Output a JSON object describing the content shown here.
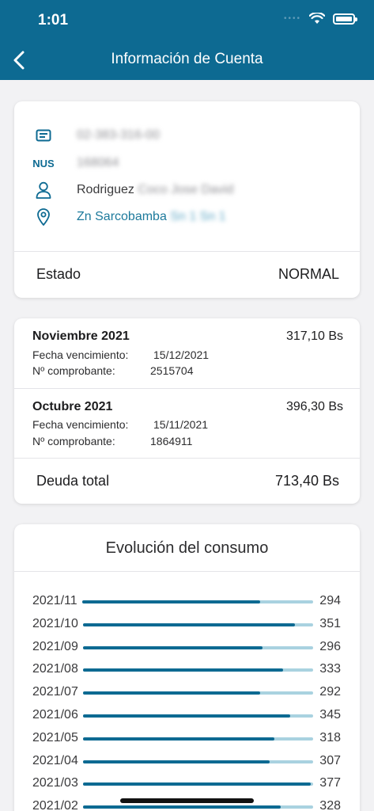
{
  "status_bar": {
    "time": "1:01",
    "icons": [
      "cellular-icon",
      "wifi-icon",
      "battery-icon"
    ]
  },
  "nav": {
    "title": "Información de Cuenta",
    "back_icon": "chevron-left-icon"
  },
  "account": {
    "code_icon": "document-icon",
    "code": "02-383-316-00",
    "nus_label": "NUS",
    "nus_value": "168064",
    "user_icon": "person-icon",
    "name_visible": "Rodriguez",
    "name_blurred": "Coco Jose David",
    "location_icon": "location-pin-icon",
    "address_visible": "Zn Sarcobamba",
    "address_blurred": "Sn 1 Sn 1",
    "estado_label": "Estado",
    "estado_value": "NORMAL"
  },
  "bills": {
    "items": [
      {
        "month": "Noviembre 2021",
        "amount": "317,10 Bs",
        "due_label": "Fecha vencimiento:",
        "due_date": "15/12/2021",
        "receipt_label": "Nº comprobante:",
        "receipt_no": "2515704"
      },
      {
        "month": "Octubre 2021",
        "amount": "396,30 Bs",
        "due_label": "Fecha vencimiento:",
        "due_date": "15/11/2021",
        "receipt_label": "Nº comprobante:",
        "receipt_no": "1864911"
      }
    ],
    "total_label": "Deuda total",
    "total_value": "713,40 Bs"
  },
  "chart_data": {
    "type": "bar",
    "title": "Evolución del consumo",
    "categories": [
      "2021/11",
      "2021/10",
      "2021/09",
      "2021/08",
      "2021/07",
      "2021/06",
      "2021/05",
      "2021/04",
      "2021/03",
      "2021/02"
    ],
    "values": [
      294,
      351,
      296,
      333,
      292,
      345,
      318,
      307,
      377,
      328
    ],
    "value_labels": [
      "294",
      "351",
      "296",
      "333",
      "292",
      "345",
      "318",
      "307",
      "377",
      "328"
    ],
    "fill_fraction": [
      0.77,
      0.92,
      0.78,
      0.87,
      0.77,
      0.9,
      0.83,
      0.81,
      0.99,
      0.86
    ]
  },
  "colors": {
    "primary": "#0d6a92",
    "track": "#a9d2e0",
    "link": "#1d7a9c",
    "background": "#f2f2f4"
  }
}
